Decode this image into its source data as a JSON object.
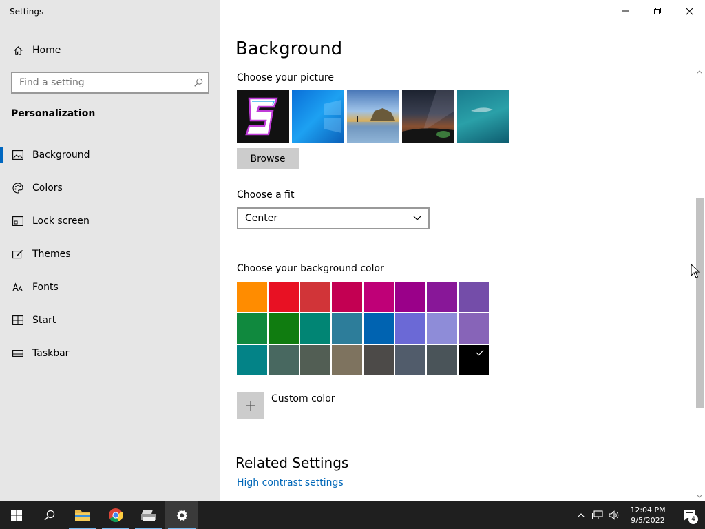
{
  "window": {
    "title": "Settings"
  },
  "sidebar": {
    "home_label": "Home",
    "search_placeholder": "Find a setting",
    "section_title": "Personalization",
    "items": [
      {
        "label": "Background",
        "icon": "picture-icon",
        "active": true
      },
      {
        "label": "Colors",
        "icon": "palette-icon",
        "active": false
      },
      {
        "label": "Lock screen",
        "icon": "lock-screen-icon",
        "active": false
      },
      {
        "label": "Themes",
        "icon": "themes-icon",
        "active": false
      },
      {
        "label": "Fonts",
        "icon": "fonts-icon",
        "active": false
      },
      {
        "label": "Start",
        "icon": "start-icon",
        "active": false
      },
      {
        "label": "Taskbar",
        "icon": "taskbar-icon",
        "active": false
      }
    ]
  },
  "main": {
    "title": "Background",
    "choose_picture_label": "Choose your picture",
    "browse_label": "Browse",
    "choose_fit_label": "Choose a fit",
    "fit_value": "Center",
    "choose_color_label": "Choose your background color",
    "colors": [
      "#ff8c00",
      "#e81123",
      "#d13438",
      "#c30052",
      "#bf0077",
      "#9a0089",
      "#881798",
      "#744da9",
      "#10893e",
      "#107c10",
      "#018574",
      "#2d7d9a",
      "#0063b1",
      "#6b69d6",
      "#8e8cd8",
      "#8764b8",
      "#038387",
      "#486860",
      "#525e54",
      "#7e735f",
      "#4c4a48",
      "#515c6b",
      "#4a5459",
      "#000000"
    ],
    "selected_color_index": 23,
    "custom_color_label": "Custom color",
    "related_title": "Related Settings",
    "related_link": "High contrast settings"
  },
  "taskbar": {
    "time": "12:04 PM",
    "date": "9/5/2022",
    "notification_count": "4"
  }
}
